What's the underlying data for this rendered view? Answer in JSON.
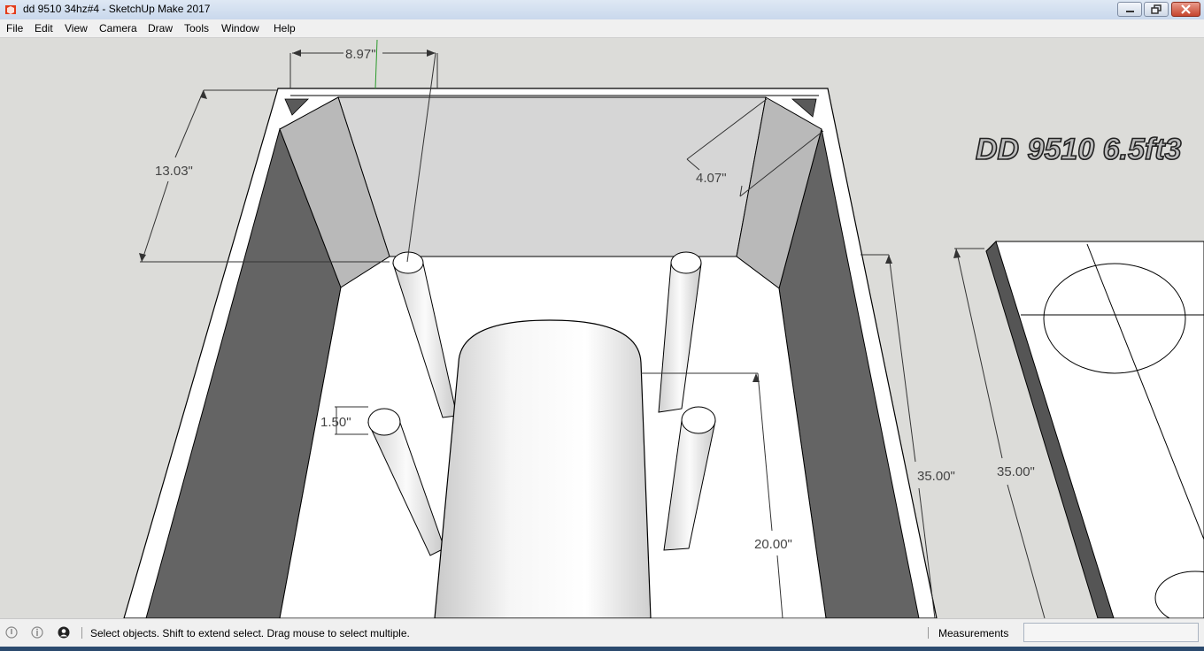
{
  "window": {
    "title": "dd 9510 34hz#4 - SketchUp Make 2017"
  },
  "menu": [
    "File",
    "Edit",
    "View",
    "Camera",
    "Draw",
    "Tools",
    "Window",
    "Help"
  ],
  "model": {
    "logo_text": "DD 9510 6.5ft3",
    "dimensions": {
      "top_width": "8.97\"",
      "left_depth": "13.03\"",
      "brace": "4.07\"",
      "port_dia": "1.50\"",
      "tube_height": "20.00\"",
      "height_a": "35.00\"",
      "height_b": "35.00\""
    }
  },
  "status": {
    "text": "Select objects. Shift to extend select. Drag mouse to select multiple.",
    "measurements_label": "Measurements",
    "measurements_value": ""
  },
  "colors": {
    "title_bg": "#dfe8f4",
    "viewport_bg": "#dcdcd9",
    "dark_face": "#646464"
  }
}
